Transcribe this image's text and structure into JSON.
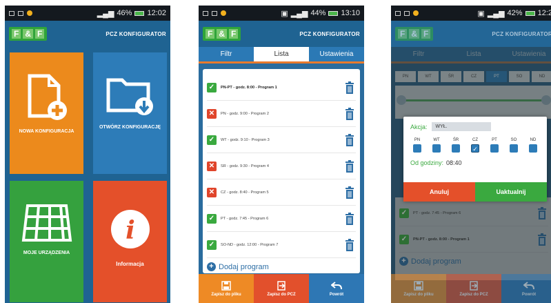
{
  "status": [
    {
      "battery": "46%",
      "time": "12:02"
    },
    {
      "battery": "44%",
      "time": "13:10"
    },
    {
      "battery": "42%",
      "time": "12:2"
    }
  ],
  "app": {
    "title": "PCZ KONFIGURATOR",
    "logo": [
      "F",
      "&",
      "F"
    ]
  },
  "screen1": {
    "tiles": [
      {
        "label": "NOWA KONFIGURACJA",
        "icon": "new-document-icon",
        "color": "#ec8a1c"
      },
      {
        "label": "OTWÓRZ KONFIGURACJĘ",
        "icon": "open-folder-icon",
        "color": "#2d7cb8"
      },
      {
        "label": "MOJE URZĄDZENIA",
        "icon": "devices-grid-icon",
        "color": "#35a13e"
      },
      {
        "label": "Informacja",
        "icon": "info-icon",
        "color": "#e4502a"
      }
    ]
  },
  "screen2": {
    "tabs": [
      "Filtr",
      "Lista",
      "Ustawienia"
    ],
    "active_tab": "Lista",
    "programs": [
      {
        "text": "PN-PT - godz. 8:00 - Program 1",
        "enabled": true
      },
      {
        "text": "PN - godz. 9:00 - Program 2",
        "enabled": false
      },
      {
        "text": "WT - godz. 9:10 - Program 3",
        "enabled": true
      },
      {
        "text": "ŚR - godz. 9:30 - Program 4",
        "enabled": false
      },
      {
        "text": "CZ - godz. 8:40 - Program 5",
        "enabled": false
      },
      {
        "text": "PT - godz. 7:45 - Program 6",
        "enabled": true
      },
      {
        "text": "SO-ND - godz. 12:00 - Program 7",
        "enabled": true
      }
    ],
    "add_label": "Dodaj program",
    "bottom": [
      "Zapisz do pliku",
      "Zapisz do PCZ",
      "Powrót"
    ]
  },
  "screen3": {
    "tabs": [
      "Filtr",
      "Lista",
      "Ustawienia"
    ],
    "days": [
      "PN",
      "WT",
      "ŚR",
      "CZ",
      "PT",
      "SO",
      "ND"
    ],
    "selected_day": "PT",
    "list": [
      {
        "text": "PT - godz. 7:45 - Program 6",
        "enabled": true
      },
      {
        "text": "PN-PT - godz. 8:00 - Program 1",
        "enabled": true
      }
    ],
    "add_label": "Dodaj program",
    "dialog": {
      "action_label": "Akcja:",
      "action_value": "WYŁ.",
      "days": [
        "PN",
        "WT",
        "ŚR",
        "CZ",
        "PT",
        "SO",
        "ND"
      ],
      "checked_day": "CZ",
      "from_label": "Od godziny:",
      "from_value": "08:40",
      "cancel": "Anuluj",
      "update": "Uaktualnij"
    },
    "bottom": [
      "Zapisz do pliku",
      "Zapisz do PCZ",
      "Powrót"
    ]
  }
}
